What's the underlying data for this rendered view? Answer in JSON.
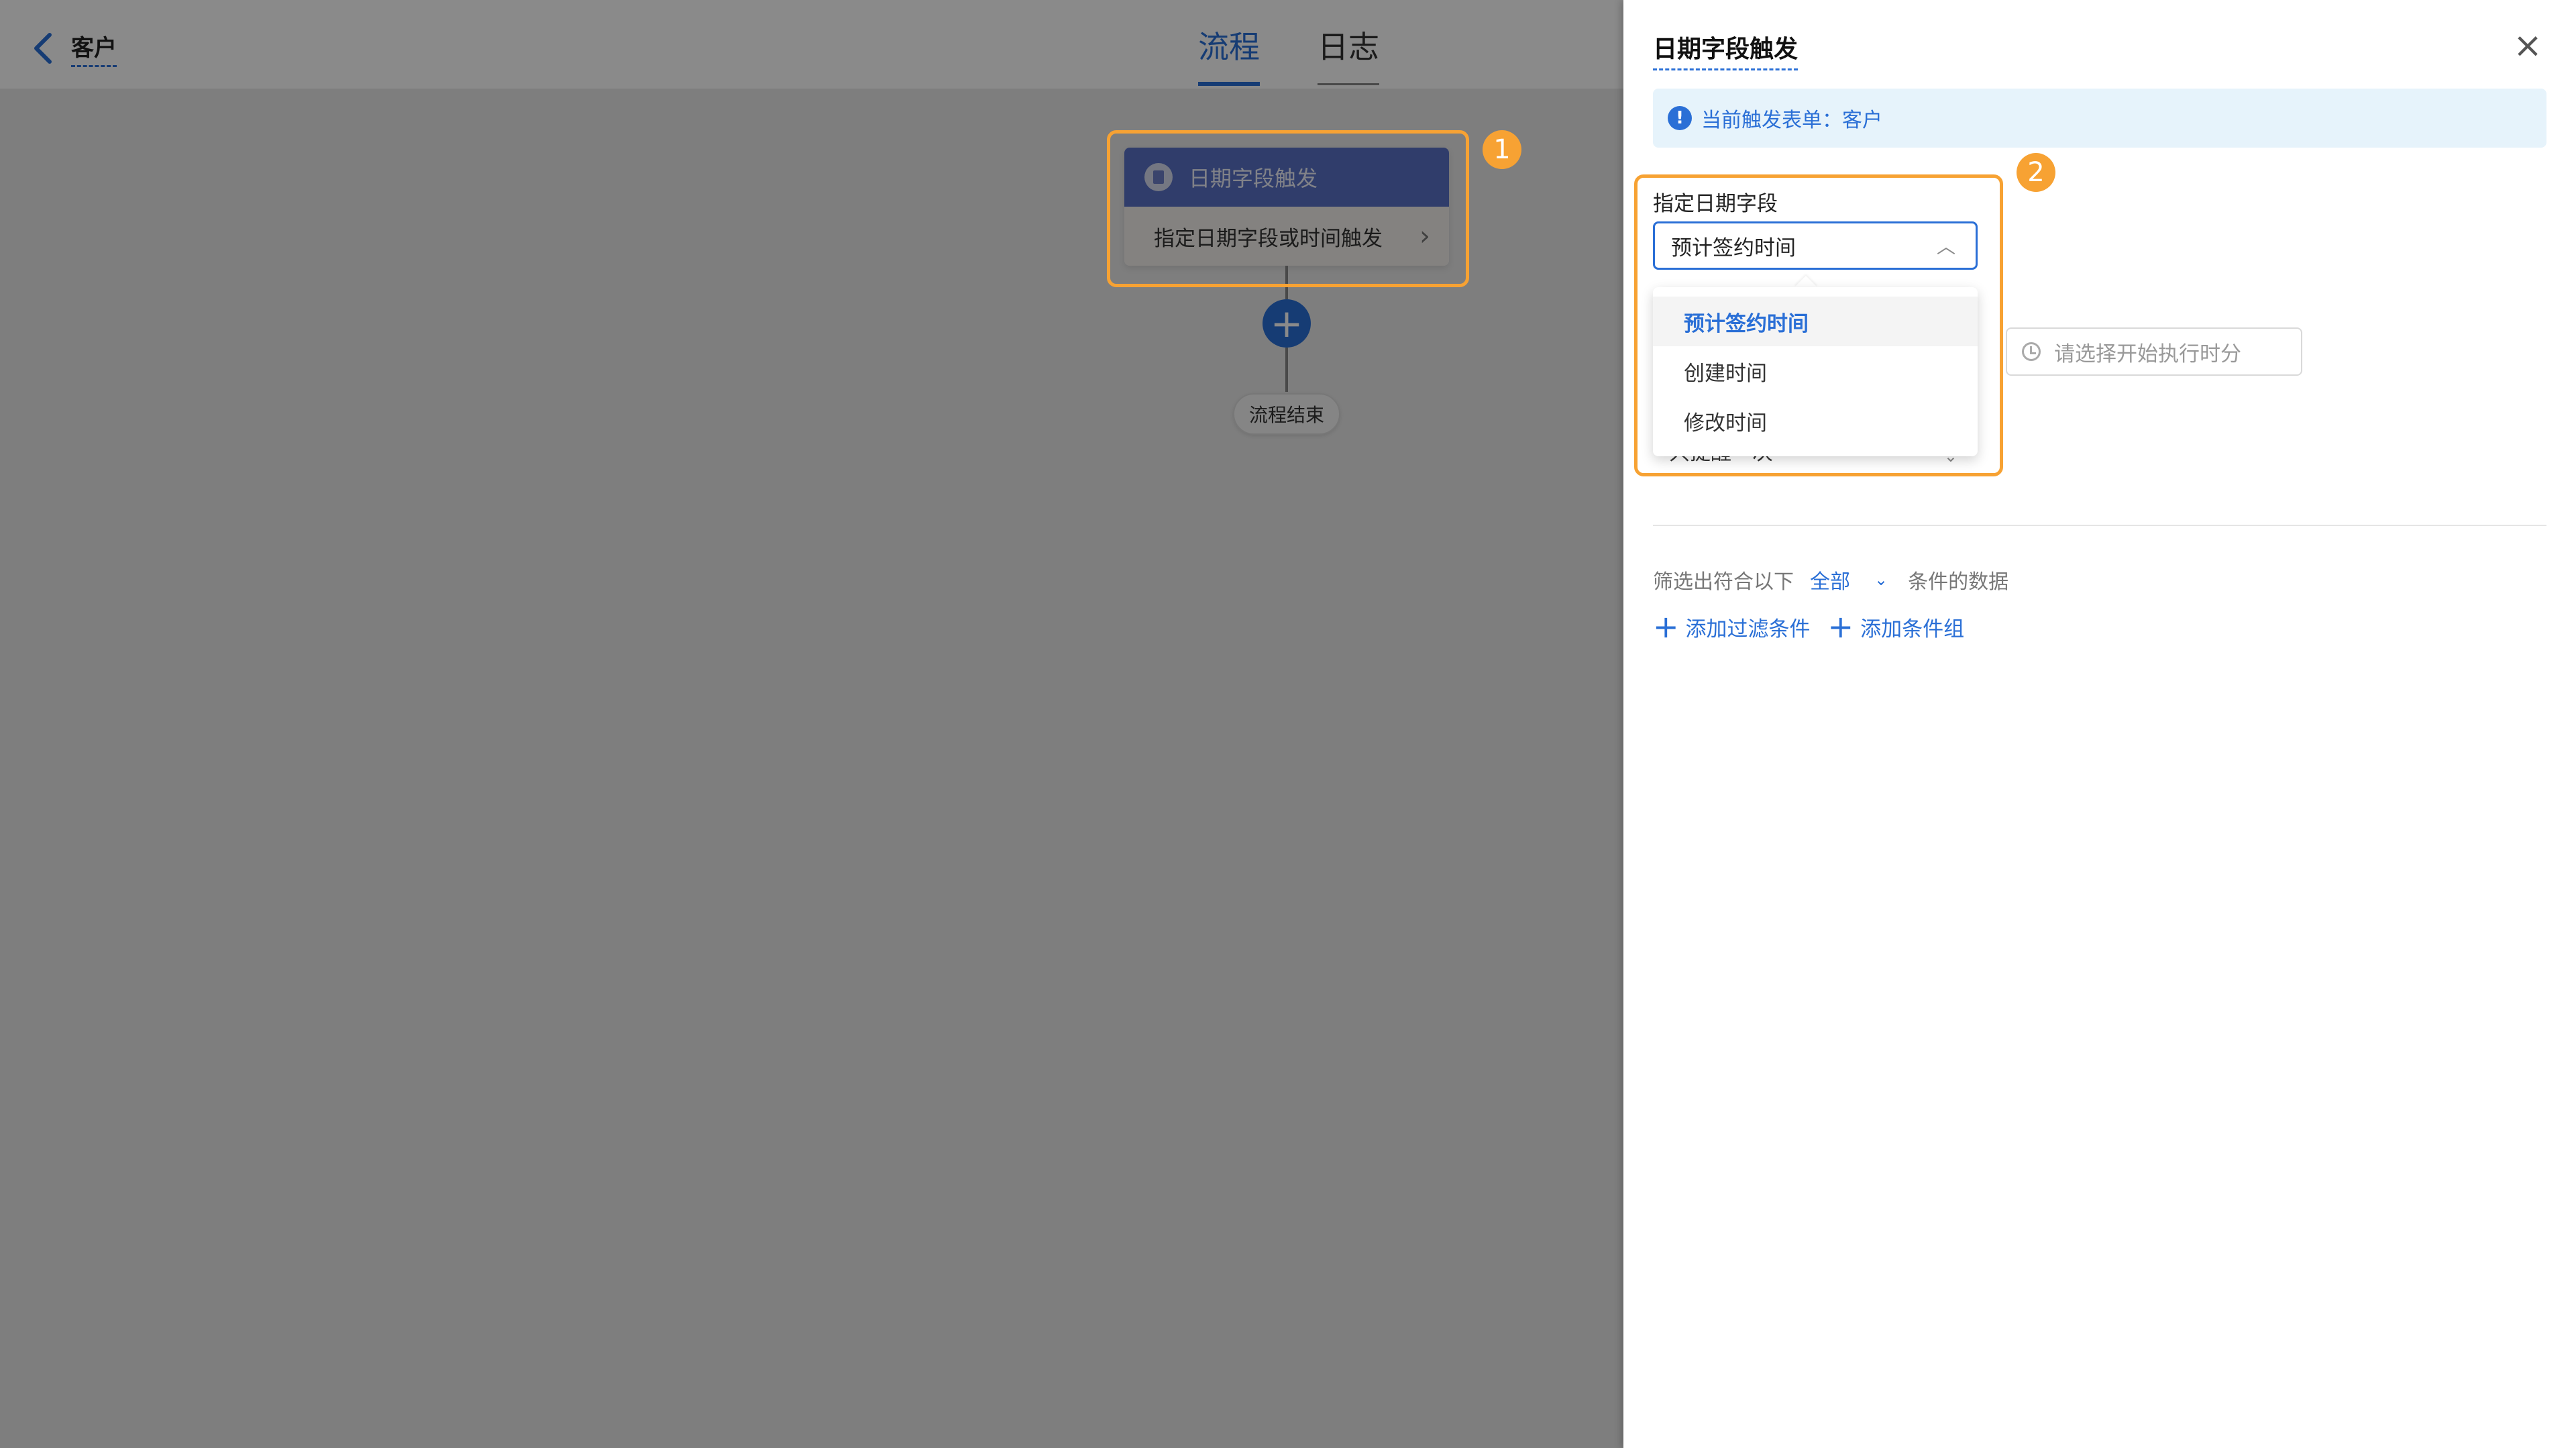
{
  "header": {
    "back_label": "客户",
    "tabs": [
      {
        "label": "流程",
        "active": true
      },
      {
        "label": "日志",
        "active": false
      }
    ]
  },
  "flow": {
    "trigger_node": {
      "title": "日期字段触发",
      "description": "指定日期字段或时间触发"
    },
    "add_button": "+",
    "end_node": "流程结束"
  },
  "annotations": {
    "badge_1": "1",
    "badge_2": "2"
  },
  "drawer": {
    "title": "日期字段触发",
    "close": "×",
    "info": {
      "icon": "!",
      "text": "当前触发表单：客户"
    },
    "date_field": {
      "label": "指定日期字段",
      "selected": "预计签约时间",
      "options": [
        "预计签约时间",
        "创建时间",
        "修改时间"
      ]
    },
    "time_input": {
      "placeholder": "请选择开始执行时分"
    },
    "repeat": {
      "value": "只提醒一次"
    },
    "filter": {
      "prefix": "筛选出符合以下",
      "mode": "全部",
      "suffix": "条件的数据"
    },
    "add_filter_label": "添加过滤条件",
    "add_group_label": "添加条件组"
  },
  "colors": {
    "accent": "#2a6fd6",
    "highlight": "#f7a233",
    "node_header": "#5a72c6",
    "info_bg": "#e6f3fb"
  }
}
